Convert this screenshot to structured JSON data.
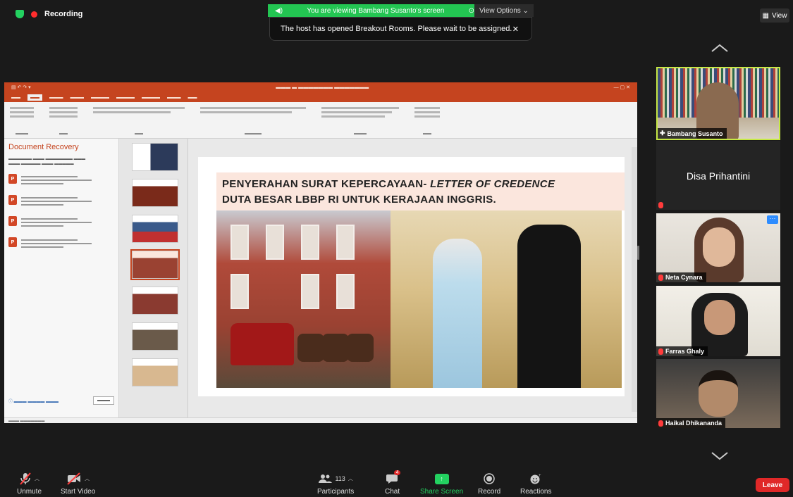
{
  "recording": {
    "label": "Recording"
  },
  "banner": {
    "viewing": "You are viewing Bambang Susanto's screen",
    "options": "View Options ⌄"
  },
  "toast": {
    "message": "The host has opened Breakout Rooms. Please wait to be assigned.",
    "close": "✕"
  },
  "view_button": {
    "label": "View"
  },
  "powerpoint": {
    "recovery_title": "Document Recovery",
    "slide_heading_line1": "PENYERAHAN SURAT KEPERCAYAAN- ",
    "slide_heading_italic": "LETTER OF CREDENCE",
    "slide_heading_line2": "DUTA BESAR LBBP RI UNTUK KERAJAAN INGGRIS."
  },
  "participants_tiles": [
    {
      "name": "Bambang Susanto"
    },
    {
      "name": "Disa Prihantini"
    },
    {
      "name": "Neta Cynara"
    },
    {
      "name": "Farras Ghaly"
    },
    {
      "name": "Haikal Dhikananda"
    }
  ],
  "toolbar": {
    "unmute": "Unmute",
    "start_video": "Start Video",
    "participants": "Participants",
    "participants_count": "113",
    "chat": "Chat",
    "chat_badge": "4",
    "share_screen": "Share Screen",
    "record": "Record",
    "reactions": "Reactions",
    "leave": "Leave"
  },
  "colors": {
    "accent_green": "#23c552",
    "powerpoint_orange": "#c5441f",
    "leave_red": "#e02828",
    "active_speaker": "#c7e945"
  }
}
